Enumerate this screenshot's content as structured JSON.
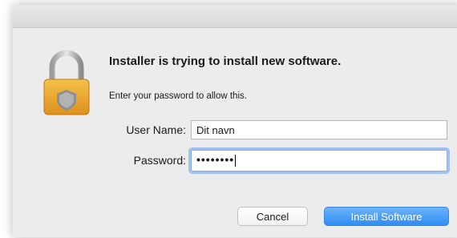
{
  "dialog": {
    "title": "Installer is trying to install new software.",
    "message": "Enter your password to allow this.",
    "icon": "lock-icon"
  },
  "fields": {
    "username_label": "User Name:",
    "username_value": "Dit navn",
    "password_label": "Password:",
    "password_mask": "••••••••"
  },
  "buttons": {
    "cancel": "Cancel",
    "install": "Install Software"
  },
  "colors": {
    "accent": "#2f8df5",
    "focus_ring": "#9fc2f0",
    "lock_gold": "#e9a72f"
  }
}
